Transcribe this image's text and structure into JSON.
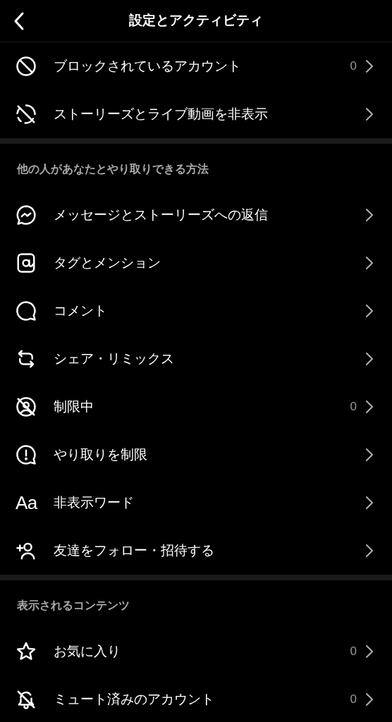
{
  "header": {
    "title": "設定とアクティビティ"
  },
  "sections": [
    {
      "items": [
        {
          "label": "ブロックされているアカウント",
          "count": "0"
        },
        {
          "label": "ストーリーズとライブ動画を非表示"
        }
      ]
    },
    {
      "title": "他の人があなたとやり取りできる方法",
      "items": [
        {
          "label": "メッセージとストーリーズへの返信"
        },
        {
          "label": "タグとメンション"
        },
        {
          "label": "コメント"
        },
        {
          "label": "シェア・リミックス"
        },
        {
          "label": "制限中",
          "count": "0"
        },
        {
          "label": "やり取りを制限"
        },
        {
          "label": "非表示ワード",
          "icon_text": "Aa"
        },
        {
          "label": "友達をフォロー・招待する"
        }
      ]
    },
    {
      "title": "表示されるコンテンツ",
      "items": [
        {
          "label": "お気に入り",
          "count": "0"
        },
        {
          "label": "ミュート済みのアカウント",
          "count": "0"
        }
      ]
    }
  ]
}
